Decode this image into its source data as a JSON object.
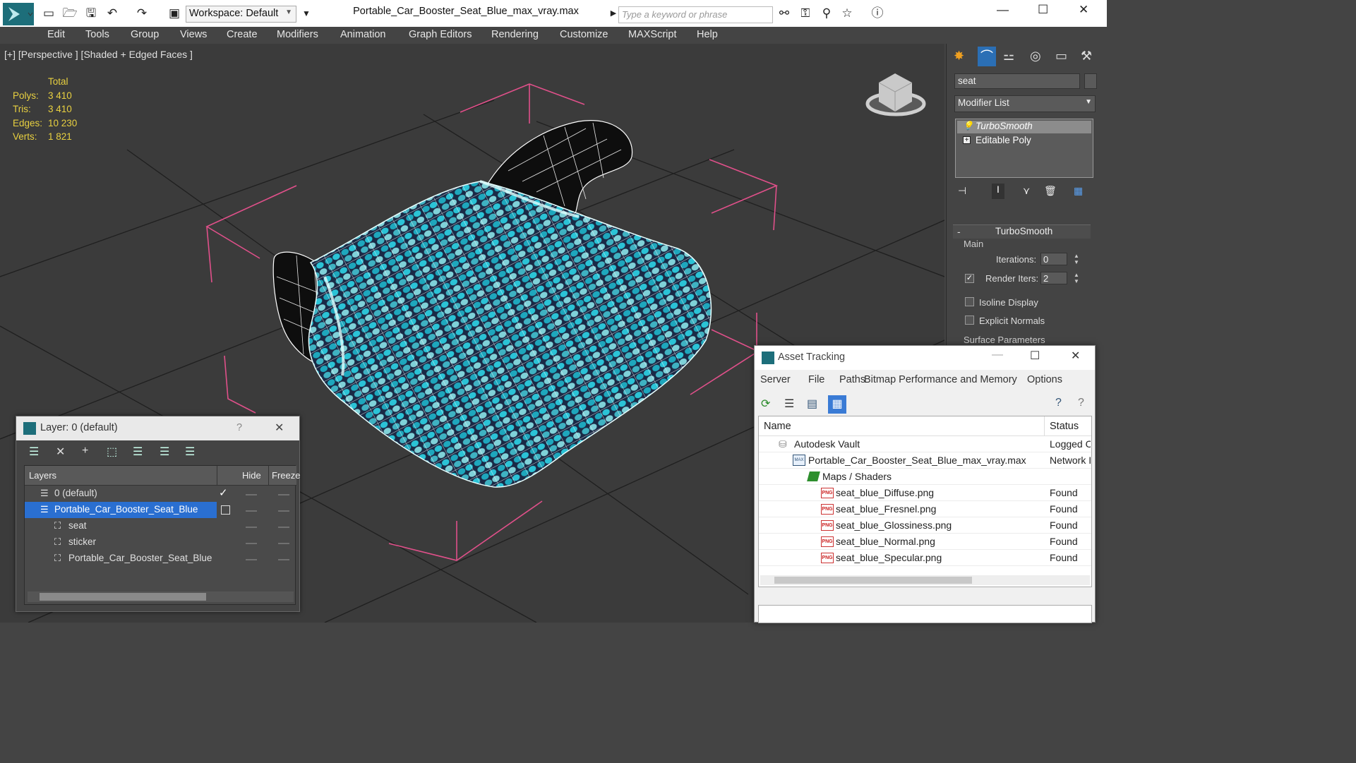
{
  "titlebar": {
    "workspace": "Workspace: Default",
    "file_title": "Portable_Car_Booster_Seat_Blue_max_vray.max",
    "search_placeholder": "Type a keyword or phrase",
    "minimize": "—",
    "maximize": "☐",
    "close": "✕"
  },
  "menu": {
    "items": [
      "Edit",
      "Tools",
      "Group",
      "Views",
      "Create",
      "Modifiers",
      "Animation",
      "Graph Editors",
      "Rendering",
      "Customize",
      "MAXScript",
      "Help"
    ]
  },
  "viewport": {
    "label": "[+] [Perspective ] [Shaded + Edged Faces ]",
    "stats": {
      "header": "Total",
      "rows": [
        {
          "label": "Polys:",
          "value": "3 410"
        },
        {
          "label": "Tris:",
          "value": "3 410"
        },
        {
          "label": "Edges:",
          "value": "10 230"
        },
        {
          "label": "Verts:",
          "value": "1 821"
        }
      ]
    }
  },
  "command_panel": {
    "object_name": "seat",
    "modifier_list": "Modifier List",
    "stack": [
      "TurboSmooth",
      "Editable Poly"
    ],
    "rollout_title": "TurboSmooth",
    "group_main": "Main",
    "iterations_label": "Iterations:",
    "iterations_value": "0",
    "render_iters_label": "Render Iters:",
    "render_iters_value": "2",
    "isoline": "Isoline Display",
    "explicit_normals": "Explicit Normals",
    "surface_params": "Surface Parameters"
  },
  "layer_window": {
    "title": "Layer: 0 (default)",
    "help": "?",
    "close": "✕",
    "col_layers": "Layers",
    "col_hide": "Hide",
    "col_freeze": "Freeze",
    "rows": [
      {
        "name": "0 (default)"
      },
      {
        "name": "Portable_Car_Booster_Seat_Blue"
      },
      {
        "name": "seat"
      },
      {
        "name": "sticker"
      },
      {
        "name": "Portable_Car_Booster_Seat_Blue"
      }
    ]
  },
  "asset_window": {
    "title": "Asset Tracking",
    "menu": [
      "Server",
      "File",
      "Paths",
      "Bitmap Performance and Memory",
      "Options"
    ],
    "col_name": "Name",
    "col_status": "Status",
    "rows": [
      {
        "name": "Autodesk Vault",
        "status": "Logged C"
      },
      {
        "name": "Portable_Car_Booster_Seat_Blue_max_vray.max",
        "status": "Network I"
      },
      {
        "name": "Maps / Shaders",
        "status": ""
      },
      {
        "name": "seat_blue_Diffuse.png",
        "status": "Found"
      },
      {
        "name": "seat_blue_Fresnel.png",
        "status": "Found"
      },
      {
        "name": "seat_blue_Glossiness.png",
        "status": "Found"
      },
      {
        "name": "seat_blue_Normal.png",
        "status": "Found"
      },
      {
        "name": "seat_blue_Specular.png",
        "status": "Found"
      }
    ],
    "png_badge": "PNG"
  },
  "colors": {
    "seat_teal": "#1ea7bd",
    "seat_dark": "#1a2a46",
    "bbox_pink": "#e0508a",
    "stats_yellow": "#e8d040",
    "selection_blue": "#2a6fd1"
  }
}
